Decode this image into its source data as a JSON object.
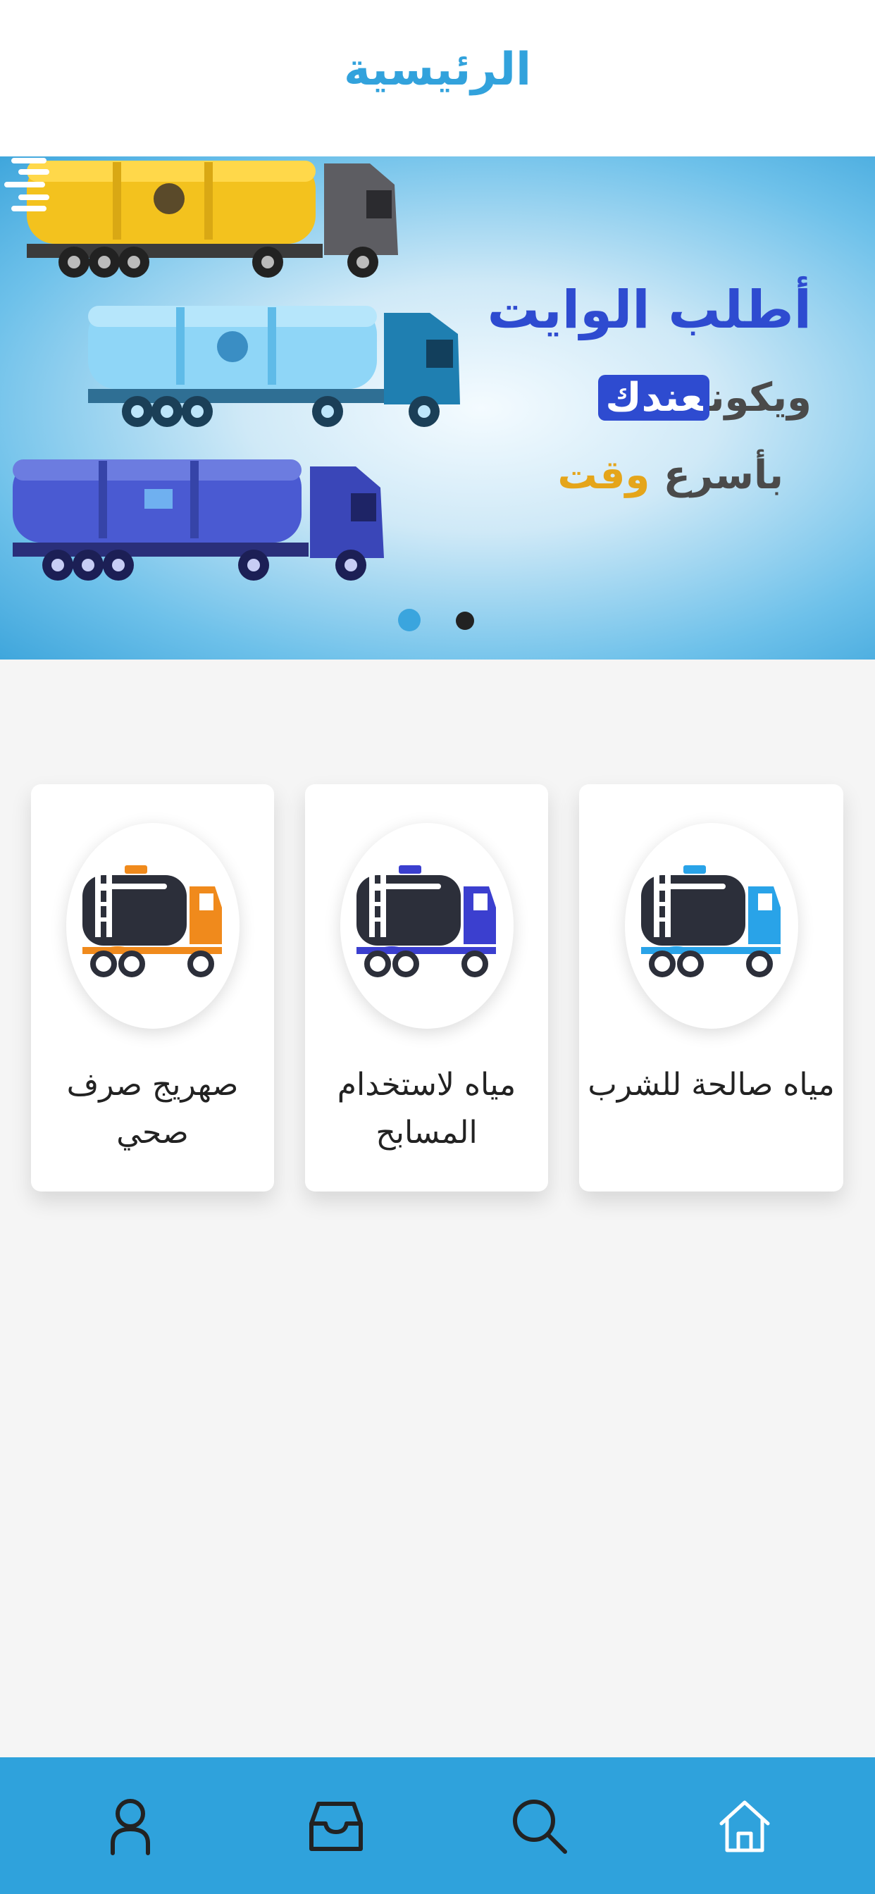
{
  "header": {
    "title": "الرئيسية"
  },
  "banner": {
    "line1": "أطلب الوايت",
    "line2_prefix": "ويكون",
    "line2_highlight": "عندك",
    "line3_prefix": "بأسرع",
    "line3_highlight": "وقت",
    "slides_count": 2,
    "active_slide": 1
  },
  "services": [
    {
      "label": "مياه صالحة للشرب",
      "accent": "#29a3e8"
    },
    {
      "label": "مياه لاستخدام المسابح",
      "accent": "#3b3fcf"
    },
    {
      "label": "صهريج صرف صحي",
      "accent": "#f08a1c"
    }
  ],
  "nav": [
    {
      "name": "home",
      "icon": "home-icon"
    },
    {
      "name": "search",
      "icon": "search-icon"
    },
    {
      "name": "orders",
      "icon": "inbox-icon"
    },
    {
      "name": "profile",
      "icon": "user-icon"
    }
  ],
  "colors": {
    "primary": "#2fa2dc",
    "truck_body": "#2c2f3a"
  }
}
